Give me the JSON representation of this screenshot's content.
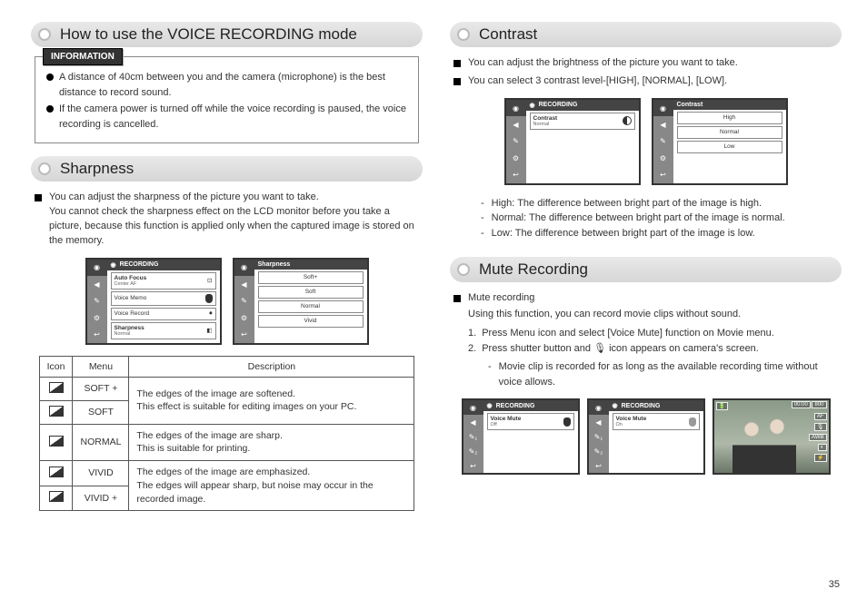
{
  "page_number": "35",
  "left": {
    "title1": "How to use the VOICE RECORDING mode",
    "info_label": "INFORMATION",
    "info_items": [
      "A distance of 40cm between you and the camera (microphone) is the best distance to record sound.",
      "If the camera power is turned off while the voice recording is paused, the voice recording is cancelled."
    ],
    "title2": "Sharpness",
    "sharp_intro_1": "You can adjust the sharpness of the picture you want to take.",
    "sharp_intro_2": "You cannot check the sharpness effect on the LCD  monitor before you take a picture, because this function is applied only when the captured image is stored on the memory.",
    "screen1": {
      "head": "RECORDING",
      "rows": [
        {
          "label": "Auto Focus",
          "sub": "Center AF"
        },
        {
          "label": "Voice Memo"
        },
        {
          "label": "Voice Record"
        },
        {
          "label": "Sharpness",
          "sub": "Normal"
        }
      ]
    },
    "screen2": {
      "head": "Sharpness",
      "rows": [
        {
          "label": "Soft+"
        },
        {
          "label": "Soft"
        },
        {
          "label": "Normal"
        },
        {
          "label": "Vivid"
        }
      ]
    },
    "table": {
      "headers": [
        "Icon",
        "Menu",
        "Description"
      ],
      "rows": [
        {
          "menu": "SOFT +",
          "desc": "The edges of the image are softened.\nThis effect is suitable for editing images on your PC.",
          "rowspan": 2
        },
        {
          "menu": "SOFT"
        },
        {
          "menu": "NORMAL",
          "desc": "The edges of the image are sharp.\nThis is suitable for printing."
        },
        {
          "menu": "VIVID",
          "desc": "The edges of the image are emphasized.\nThe edges will appear sharp, but noise may occur in the recorded image.",
          "rowspan": 2
        },
        {
          "menu": "VIVID +"
        }
      ]
    }
  },
  "right": {
    "title1": "Contrast",
    "contrast_1": "You can adjust the brightness of the picture you want to take.",
    "contrast_2": "You can select 3 contrast level-[HIGH], [NORMAL], [LOW].",
    "screen1": {
      "head": "RECORDING",
      "rows": [
        {
          "label": "Contrast",
          "sub": "Normal"
        }
      ]
    },
    "screen2": {
      "head": "Contrast",
      "rows": [
        {
          "label": "High"
        },
        {
          "label": "Normal"
        },
        {
          "label": "Low"
        }
      ]
    },
    "contrast_levels": [
      "High: The difference between bright part of the image is high.",
      "Normal: The difference between bright part of the image is normal.",
      "Low: The difference between bright part of the image is low."
    ],
    "title2": "Mute Recording",
    "mute_1": "Mute recording",
    "mute_intro": "Using this function, you can record movie clips without sound.",
    "mute_steps": [
      "Press Menu icon and select [Voice Mute] function on Movie menu.",
      "Press shutter button and 🎙 icon appears on camera's screen."
    ],
    "mute_sub": "Movie clip is recorded for as long as the available recording time without voice allows.",
    "screen3": {
      "head": "RECORDING",
      "rows": [
        {
          "label": "Voice Mute",
          "sub": "Off"
        }
      ]
    },
    "screen4": {
      "head": "RECORDING",
      "rows": [
        {
          "label": "Voice Mute",
          "sub": "On"
        }
      ]
    },
    "photo": {
      "top_left": "🔋",
      "top_right_1": "00:00",
      "top_right_2": "800",
      "side": [
        "AF",
        "🎙",
        "AWB",
        "◐",
        "⚡"
      ]
    }
  }
}
